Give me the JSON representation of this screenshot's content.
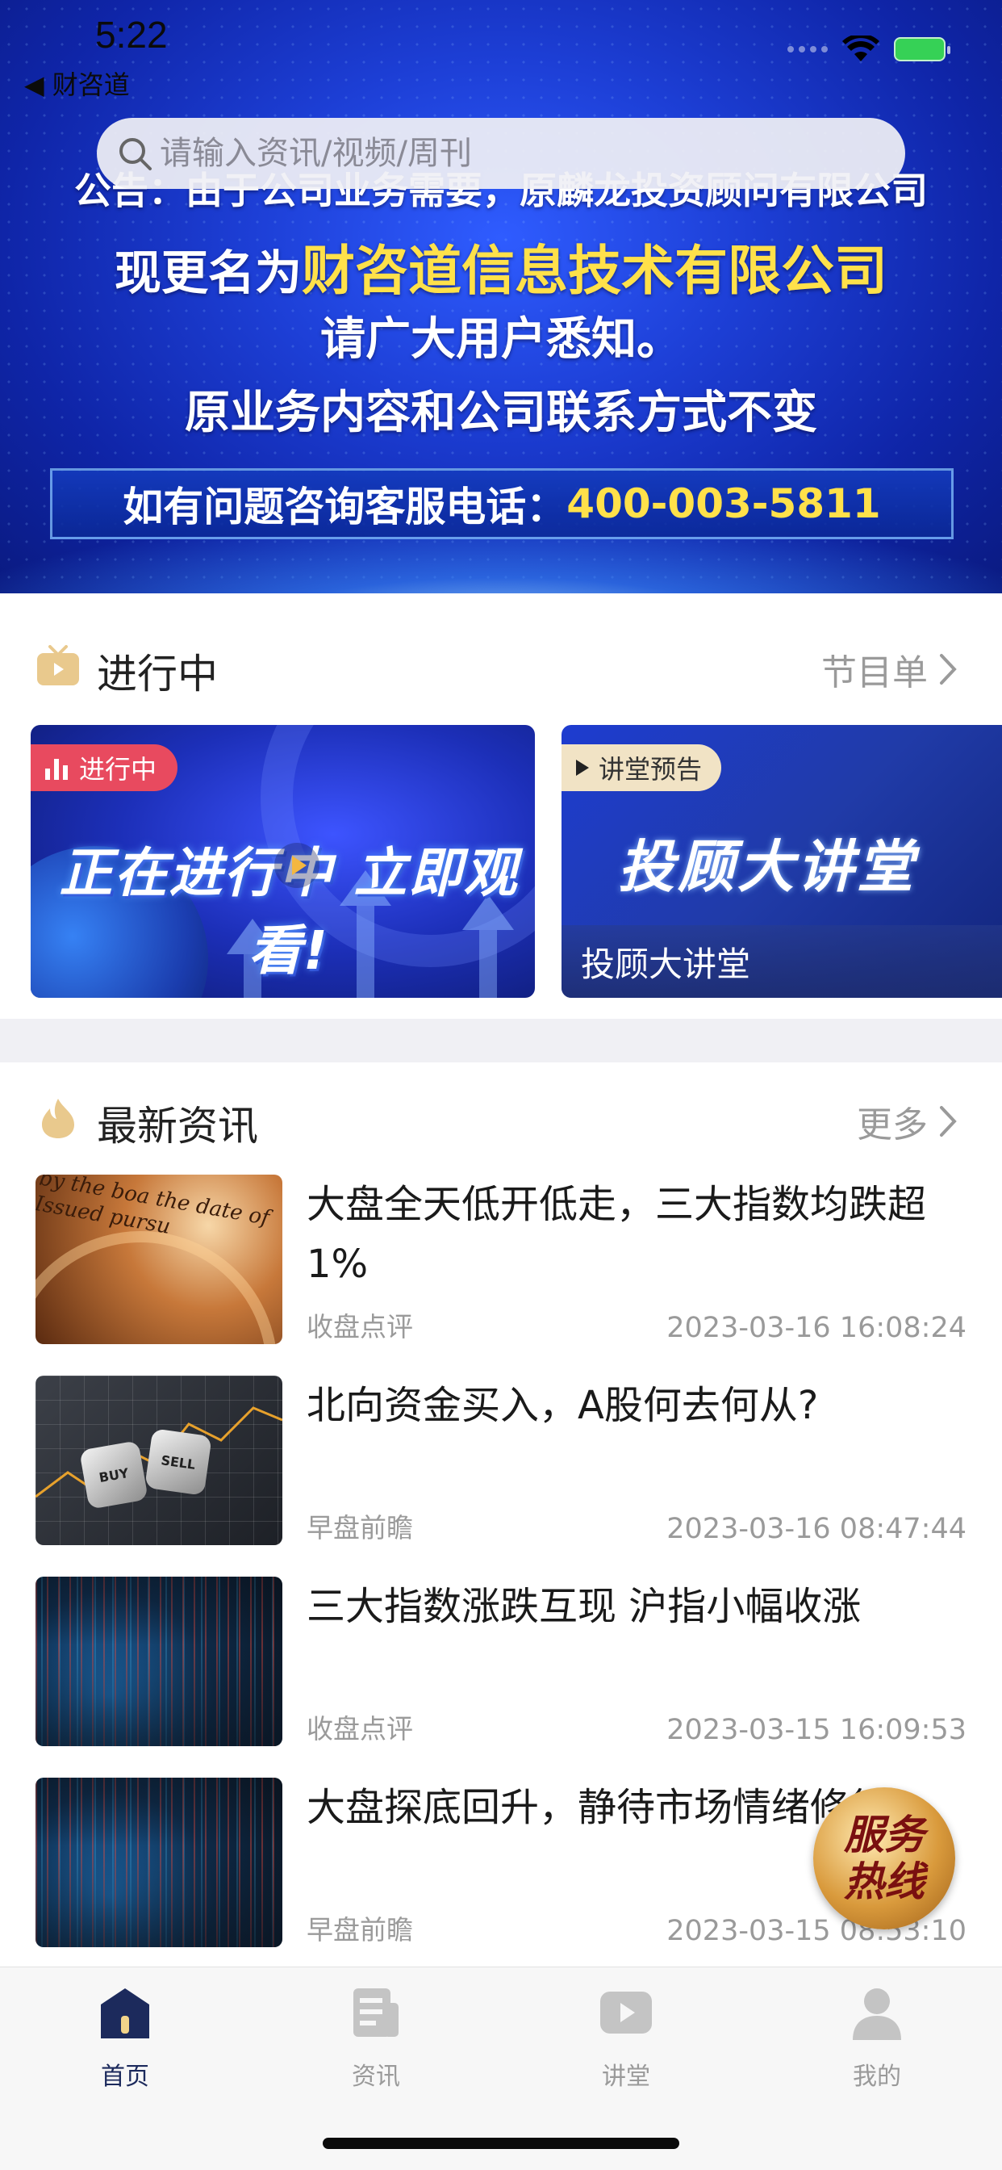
{
  "status_bar": {
    "time": "5:22",
    "back_label": "◀ 财咨道"
  },
  "search": {
    "placeholder": "请输入资讯/视频/周刊"
  },
  "banner": {
    "line1": "公告：由于公司业务需要，原麟龙投资顾问有限公司",
    "line2_prefix": "现更名为",
    "line2_highlight": "财咨道信息技术有限公司",
    "line3": "请广大用户悉知。",
    "line4": "原业务内容和公司联系方式不变",
    "hotline_prefix": "如有问题咨询客服电话：",
    "hotline_number": "400-003-5811",
    "highlight_color": "#ffe14a"
  },
  "live_section": {
    "title": "进行中",
    "more_label": "节目单",
    "cards": [
      {
        "tag": "进行中",
        "slogan": "正在进行中 立即观看!"
      },
      {
        "tag": "讲堂预告",
        "big_title": "投顾大讲堂",
        "caption": "投顾大讲堂"
      }
    ]
  },
  "news_section": {
    "title": "最新资讯",
    "more_label": "更多",
    "items": [
      {
        "title": "大盘全天低开低走，三大指数均跌超1%",
        "category": "收盘点评",
        "time": "2023-03-16 16:08:24"
      },
      {
        "title": "北向资金买入，A股何去何从?",
        "category": "早盘前瞻",
        "time": "2023-03-16 08:47:44"
      },
      {
        "title": "三大指数涨跌互现 沪指小幅收涨",
        "category": "收盘点评",
        "time": "2023-03-15 16:09:53"
      },
      {
        "title": "大盘探底回升，静待市场情绪修复",
        "category": "早盘前瞻",
        "time": "2023-03-15 08:53:10"
      }
    ]
  },
  "thumb_text": {
    "coin": "by the boa the date of Issued pursu",
    "dice_buy": "BUY",
    "dice_sell": "SELL"
  },
  "service_badge": {
    "line1": "服务",
    "line2": "热线"
  },
  "tabbar": {
    "items": [
      {
        "label": "首页",
        "active": true
      },
      {
        "label": "资讯",
        "active": false
      },
      {
        "label": "讲堂",
        "active": false
      },
      {
        "label": "我的",
        "active": false
      }
    ],
    "active_color": "#1c2a5c",
    "inactive_color": "#9a9a9a"
  }
}
